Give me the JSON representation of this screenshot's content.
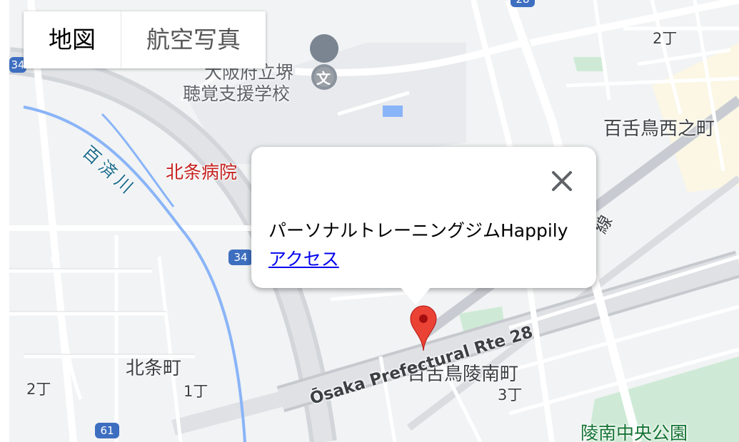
{
  "map_type": {
    "map_label": "地図",
    "satellite_label": "航空写真",
    "selected": "map"
  },
  "info_window": {
    "place_name": "パーソナルトレーニングジムHappily",
    "link_text": "アクセス"
  },
  "labels": {
    "school_line1": "大阪府立堺",
    "school_line2": "聴覚支援学校",
    "hospital": "北条病院",
    "river": "百済川",
    "district_mozu_nishi": "百舌鳥西之町",
    "chome_2_top": "2丁",
    "district_hojo": "北条町",
    "chome_2_left": "2丁",
    "chome_1": "1丁",
    "district_mozu_ryonan": "百舌鳥陵南町",
    "chome_3": "3丁",
    "park": "陵南中央公園",
    "road_name": "Ōsaka Prefectural Rte 28",
    "rail_line_fragment": "線"
  },
  "route_shields": {
    "route_34_top": "34",
    "route_34_mid": "34",
    "route_61": "61",
    "route_top_partial": "28"
  },
  "colors": {
    "marker_red": "#ea4335",
    "hospital_text": "#c5221f",
    "park_text": "#137333",
    "shield_blue": "#3d6ec0",
    "water": "#8ab4f8"
  }
}
